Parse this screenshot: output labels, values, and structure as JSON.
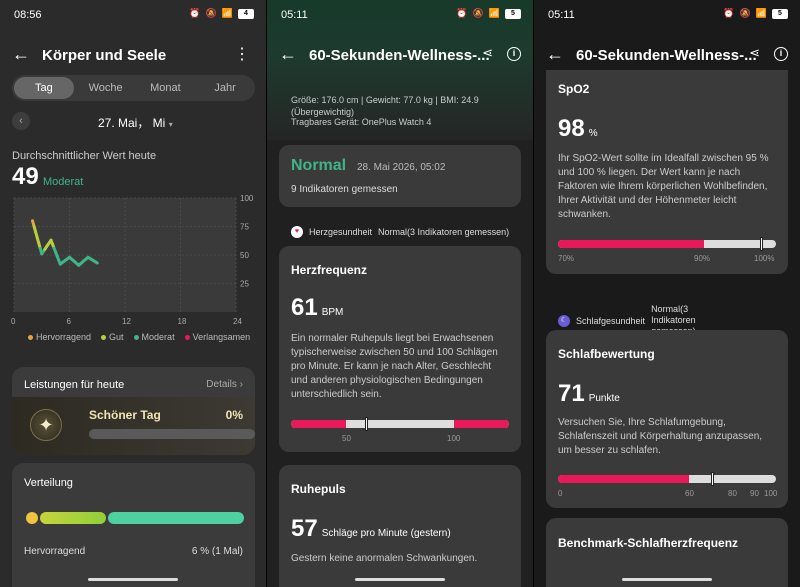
{
  "panel1": {
    "time": "08:56",
    "battery": "4",
    "title": "Körper und Seele",
    "tabs": [
      "Tag",
      "Woche",
      "Monat",
      "Jahr"
    ],
    "date": "27. Mai， Mi",
    "avg_label": "Durchschnittlicher Wert heute",
    "avg_value": "49",
    "avg_tag": "Moderat",
    "chart_data": {
      "type": "line",
      "x": [
        2,
        3,
        4,
        5,
        6,
        7,
        8,
        9
      ],
      "y": [
        80,
        51,
        63,
        42,
        48,
        41,
        48,
        43
      ],
      "ylim": [
        0,
        100
      ],
      "xlim": [
        0,
        24
      ],
      "x_ticks": [
        "0",
        "6",
        "12",
        "18",
        "24"
      ],
      "y_ticks": [
        "100",
        "75",
        "50",
        "25"
      ],
      "legend": [
        "Hervorragend",
        "Gut",
        "Moderat",
        "Verlangsamen"
      ],
      "colors": [
        "#e8a23c",
        "#b9cf3a",
        "#3fb489",
        "#e8185a"
      ]
    },
    "leistungen_title": "Leistungen für heute",
    "details_label": "Details",
    "achievement_name": "Schöner Tag",
    "achievement_pct": "0%",
    "achievement_icon": "sparkle-icon",
    "verteilung_title": "Verteilung",
    "dist_row_label": "Hervorragend",
    "dist_row_value": "6 % (1 Mal)"
  },
  "panel2": {
    "time": "05:11",
    "battery": "5",
    "title": "60-Sekunden-Wellness-...",
    "meta_line": "Größe: 176.0 cm | Gewicht: 77.0 kg | BMI: 24.9",
    "meta_line2": "(Übergewichtig)",
    "device": "Tragbares Gerät: OnePlus Watch 4",
    "status": "Normal",
    "status_date": "28. Mai 2026, 05:02",
    "indicators": "9 Indikatoren gemessen",
    "section_heart": "Herzgesundheit",
    "section_heart_status": "Normal(3 Indikatoren gemessen)",
    "hr_title": "Herzfrequenz",
    "hr_value": "61",
    "hr_unit": "BPM",
    "hr_desc": "Ein normaler Ruhepuls liegt bei Erwachsenen typischerweise zwischen 50 und 100 Schlägen pro Minute. Er kann je nach Alter, Geschlecht und anderen physiologischen Bedingungen unterschiedlich sein.",
    "hr_ticks": [
      "50",
      "100"
    ],
    "hr_value_num": 61,
    "rp_title": "Ruhepuls",
    "rp_value": "57",
    "rp_unit": "Schläge pro Minute (gestern)",
    "rp_desc": "Gestern keine anormalen Schwankungen."
  },
  "panel3": {
    "time": "05:11",
    "battery": "5",
    "title": "60-Sekunden-Wellness-...",
    "spo2_title": "SpO2",
    "spo2_value": "98",
    "spo2_unit": "%",
    "spo2_desc": "Ihr SpO2-Wert sollte im Idealfall zwischen 95 % und 100 % liegen. Der Wert kann je nach Faktoren wie Ihrem körperlichen Wohlbefinden, Ihrer Aktivität und der Höhenmeter leicht schwanken.",
    "spo2_ticks": [
      "70%",
      "90%",
      "100%"
    ],
    "spo2_value_num": 98,
    "section_sleep": "Schlafgesundheit",
    "section_sleep_status": "Normal(3 Indikatoren gemessen)",
    "sleep_title": "Schlafbewertung",
    "sleep_value": "71",
    "sleep_unit": "Punkte",
    "sleep_desc": "Versuchen Sie, Ihre Schlafumgebung, Schlafenszeit und Körperhaltung anzupassen, um besser zu schlafen.",
    "sleep_ticks": [
      "0",
      "60",
      "80",
      "90",
      "100"
    ],
    "sleep_value_num": 71,
    "bench_title": "Benchmark-Schlafherzfrequenz"
  },
  "colors": {
    "accent_green": "#3fb489",
    "accent_red": "#e8185a"
  }
}
